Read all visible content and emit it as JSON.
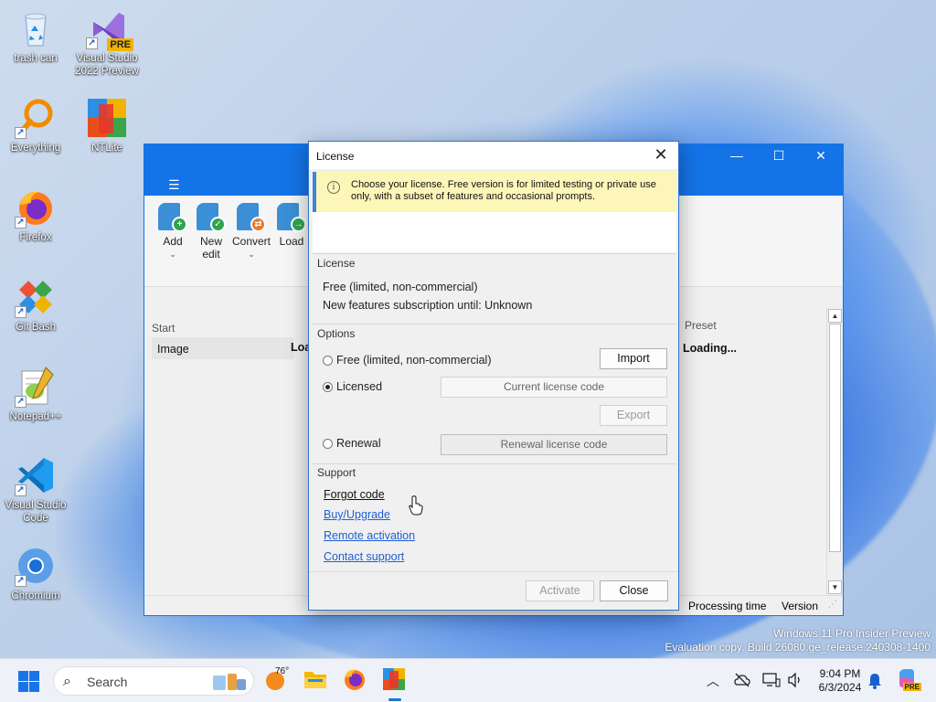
{
  "desktop": {
    "icons": [
      {
        "label": "trash can"
      },
      {
        "label": "Visual Studio 2022 Preview",
        "badge": "PRE"
      },
      {
        "label": "Everything"
      },
      {
        "label": "NTLite"
      },
      {
        "label": "Firefox"
      },
      {
        "label": "Git Bash"
      },
      {
        "label": "Notepad++"
      },
      {
        "label": "Visual Studio Code"
      },
      {
        "label": "Chromium"
      }
    ],
    "watermark_line1": "Windows 11 Pro Insider Preview",
    "watermark_line2": "Evaluation copy. Build 26080.ge_release.240308-1400"
  },
  "app": {
    "menu_icon": "☰",
    "ribbon": [
      {
        "label": "Add",
        "has_dropdown": true
      },
      {
        "label": "New edit",
        "has_dropdown": false
      },
      {
        "label": "Convert",
        "has_dropdown": true
      },
      {
        "label": "Load",
        "has_dropdown": false
      }
    ],
    "grid": {
      "col_start": "Start",
      "cell_image": "Image",
      "cell_loa": "Loa",
      "col_preset": "Preset",
      "cell_loading": "Loading..."
    },
    "status": {
      "processing_time": "Processing time",
      "version": "Version"
    }
  },
  "dialog": {
    "title": "License",
    "info": "Choose your license. Free version is for limited testing or private use only, with a subset of features and occasional prompts.",
    "license_section": "License",
    "license_type": "Free (limited, non-commercial)",
    "subscription": "New features subscription until: Unknown",
    "options_section": "Options",
    "options": [
      {
        "label": "Free (limited, non-commercial)",
        "selected": false
      },
      {
        "label": "Licensed",
        "selected": true
      },
      {
        "label": "Renewal",
        "selected": false
      }
    ],
    "import_label": "Import",
    "current_license_placeholder": "Current license code",
    "export_label": "Export",
    "renewal_placeholder": "Renewal license code",
    "support_section": "Support",
    "links": [
      {
        "label": "Forgot code",
        "hover": true
      },
      {
        "label": "Buy/Upgrade",
        "hover": false
      },
      {
        "label": "Remote activation",
        "hover": false
      },
      {
        "label": "Contact support",
        "hover": false
      }
    ],
    "activate_label": "Activate",
    "close_label": "Close"
  },
  "taskbar": {
    "search_placeholder": "Search",
    "weather_temp": "76°",
    "time": "9:04 PM",
    "date": "6/3/2024",
    "copilot_badge": "PRE"
  },
  "colors": {
    "accent": "#1473e6",
    "link": "#1f5fd4",
    "info_bg": "#fdf6b9"
  }
}
